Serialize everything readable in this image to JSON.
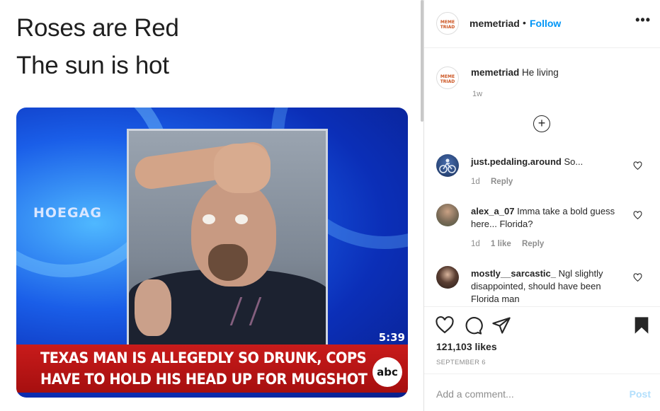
{
  "post_media": {
    "caption_line_1": "Roses are Red",
    "caption_line_2": "The sun is hot",
    "watermark": "HOEGAG",
    "timestamp": "5:39",
    "ticker_line_1": "TEXAS MAN IS ALLEGEDLY SO DRUNK, COPS",
    "ticker_line_2": "HAVE TO HOLD HIS HEAD UP FOR MUGSHOT",
    "network_logo": "abc"
  },
  "header": {
    "avatar_text": "MEME TRIAD",
    "username": "memetriad",
    "separator": "•",
    "follow_label": "Follow",
    "more_icon": "more-horizontal-icon"
  },
  "caption": {
    "username": "memetriad",
    "text": "He living",
    "time": "1w"
  },
  "load_more_icon": "plus-circle-icon",
  "comments": [
    {
      "username": "just.pedaling.around",
      "text": "So...",
      "time": "1d",
      "likes": "",
      "reply_label": "Reply"
    },
    {
      "username": "alex_a_07",
      "text": "Imma take a bold guess here... Florida?",
      "time": "1d",
      "likes": "1 like",
      "reply_label": "Reply"
    },
    {
      "username": "mostly__sarcastic_",
      "text": "Ngl slightly disappointed, should have been Florida man",
      "time": "",
      "likes": "",
      "reply_label": ""
    }
  ],
  "actions": {
    "like_icon": "heart-icon",
    "comment_icon": "comment-icon",
    "share_icon": "send-icon",
    "save_icon": "bookmark-icon",
    "likes_count": "121,103 likes",
    "date": "SEPTEMBER 6"
  },
  "add_comment": {
    "placeholder": "Add a comment...",
    "post_label": "Post"
  },
  "colors": {
    "link_blue": "#0095f6",
    "post_disabled": "#b2dffc",
    "muted": "#8e8e8e",
    "ticker_red": "#c81b1b"
  }
}
